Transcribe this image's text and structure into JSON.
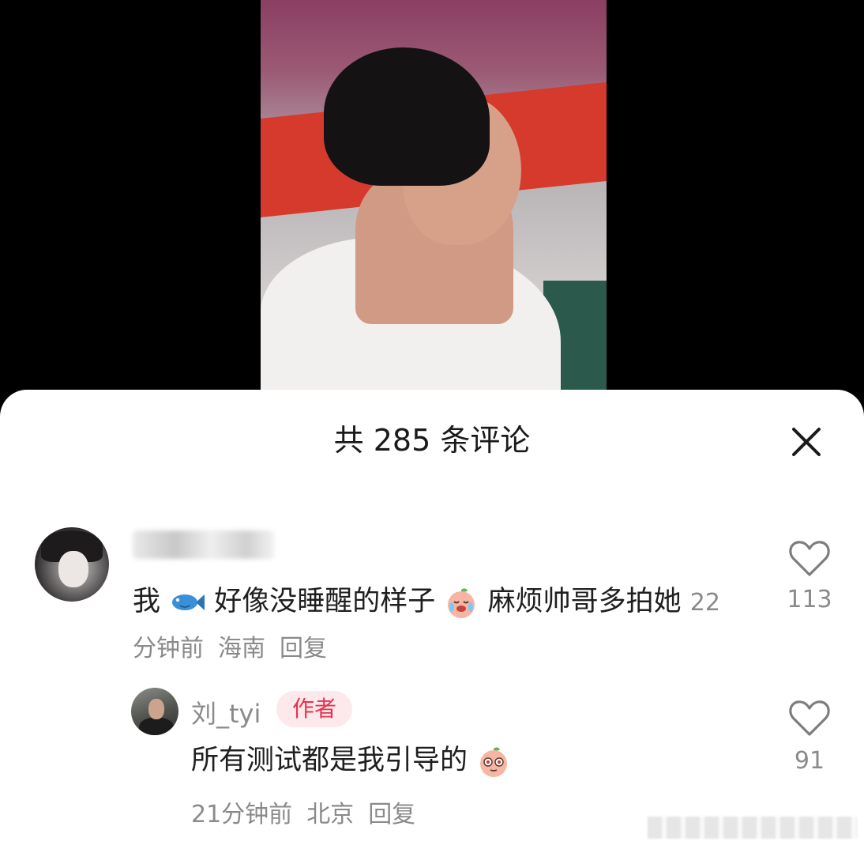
{
  "sheet": {
    "title": "共 285 条评论"
  },
  "comments": [
    {
      "text_part1": "我",
      "text_part2": "好像没睡醒的样子",
      "text_part3": " 麻烦帅哥多拍她",
      "time": "22分钟前",
      "location": "海南",
      "reply_label": "回复",
      "likes": "113"
    }
  ],
  "reply": {
    "username": "刘_tyi",
    "badge": "作者",
    "text": "所有测试都是我引导的",
    "time": "21分钟前",
    "location": "北京",
    "reply_label": "回复",
    "likes": "91"
  },
  "icons": {
    "close": "close-icon",
    "like": "heart-outline-icon",
    "fish": "fish-emoji-icon",
    "crying": "peach-crying-emoji-icon",
    "shy": "peach-shy-emoji-icon"
  },
  "colors": {
    "author_badge_bg": "#fde9ec",
    "author_badge_text": "#e5334f",
    "meta_text": "#8a8a8a"
  }
}
